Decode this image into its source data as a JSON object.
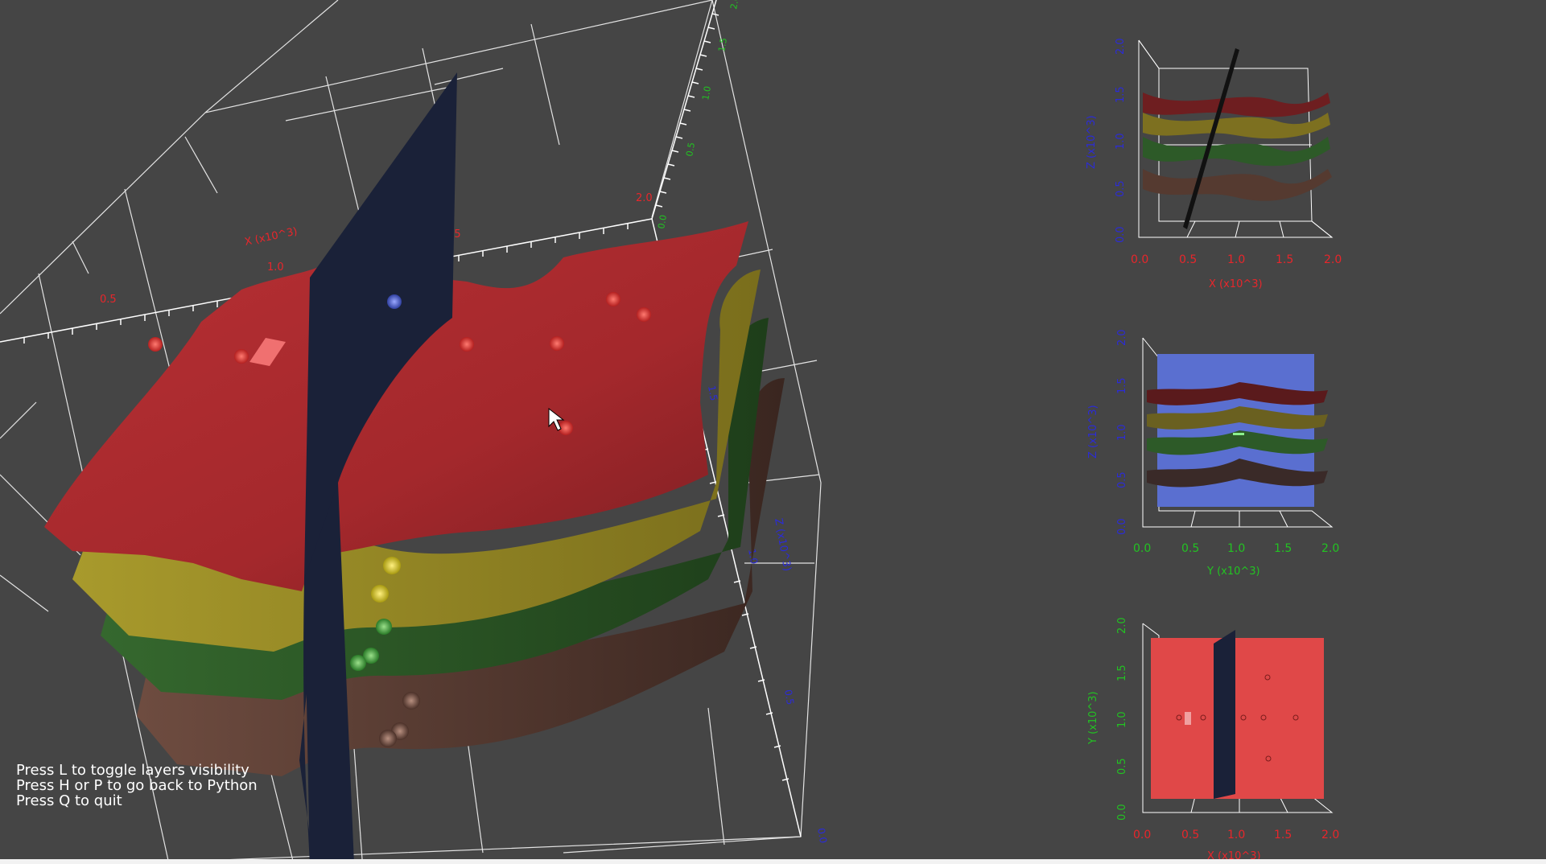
{
  "colors": {
    "background": "#454545",
    "x_axis": "#e8262b",
    "y_axis": "#22c322",
    "z_axis": "#2b2bd8",
    "layer_red": "#a8282c",
    "layer_yellow": "#9c8e22",
    "layer_green": "#2d5a28",
    "layer_brown": "#553a30",
    "cut_plane": "#1a2138",
    "blue_slice": "#5a6fd0"
  },
  "help": {
    "line1": "Press L to toggle layers visibility",
    "line2": "Press H or P to go back to Python",
    "line3": "Press Q to quit"
  },
  "main_view": {
    "x_title": "X (x10^3)",
    "x_ticks": [
      "0.5",
      "1.0",
      "1.5",
      "2.0"
    ],
    "y_ticks": [
      "0.0",
      "0.5",
      "1.0",
      "1.5",
      "2.0"
    ],
    "z_title": "Z (x10^3)",
    "z_ticks": [
      "0.0",
      "0.5",
      "1.0",
      "1.5"
    ]
  },
  "views": {
    "xz": {
      "xlabel": "X (x10^3)",
      "ylabel": "Z (x10^3)",
      "xticks": [
        "0.0",
        "0.5",
        "1.0",
        "1.5",
        "2.0"
      ],
      "yticks": [
        "0.0",
        "0.5",
        "1.0",
        "1.5",
        "2.0"
      ]
    },
    "yz": {
      "xlabel": "Y (x10^3)",
      "ylabel": "Z (x10^3)",
      "xticks": [
        "0.0",
        "0.5",
        "1.0",
        "1.5",
        "2.0"
      ],
      "yticks": [
        "0.0",
        "0.5",
        "1.0",
        "1.5",
        "2.0"
      ]
    },
    "xy": {
      "xlabel": "X (x10^3)",
      "ylabel": "Y (x10^3)",
      "xticks": [
        "0.0",
        "0.5",
        "1.0",
        "1.5",
        "2.0"
      ],
      "yticks": [
        "0.0",
        "0.5",
        "1.0",
        "1.5",
        "2.0"
      ]
    }
  }
}
